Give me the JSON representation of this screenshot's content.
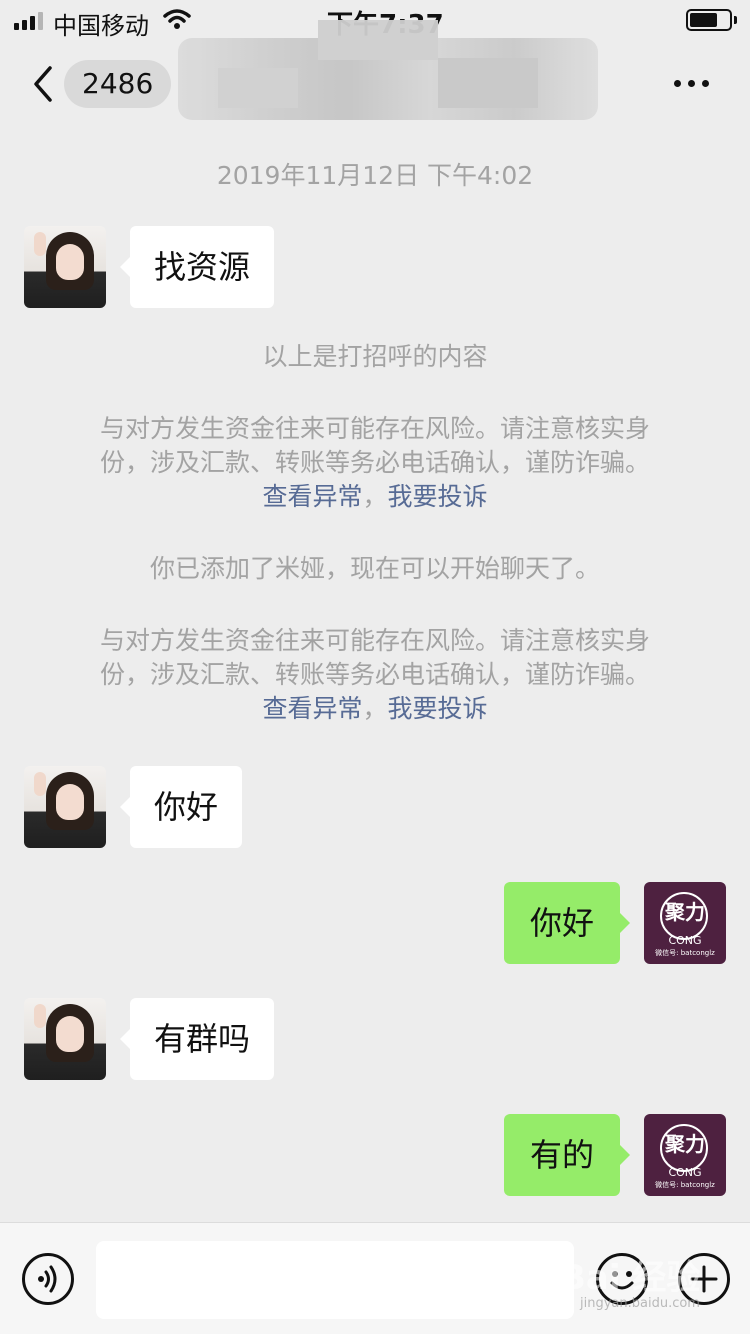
{
  "status_bar": {
    "carrier": "中国移动",
    "time": "下午7:37",
    "battery_level": 0.7,
    "icons": [
      "signal-icon",
      "wifi-icon",
      "battery-icon"
    ]
  },
  "nav": {
    "back_icon": "chevron-left-icon",
    "unread_count": "2486",
    "more_icon": "more-dots-icon"
  },
  "chat": {
    "timestamp": "2019年11月12日 下午4:02",
    "messages": [
      {
        "side": "left",
        "text": "找资源"
      },
      {
        "side": "left",
        "text": "你好"
      },
      {
        "side": "right",
        "text": "你好"
      },
      {
        "side": "left",
        "text": "有群吗"
      },
      {
        "side": "right",
        "text": "有的"
      }
    ],
    "system_notes": {
      "greeting_note": "以上是打招呼的内容",
      "risk_line1": "与对方发生资金往来可能存在风险。请注意核实身",
      "risk_line2": "份，涉及汇款、转账等务必电话确认，谨防诈骗。",
      "view_link": "查看异常",
      "separator": "，",
      "report_link": "我要投诉",
      "added_note": "你已添加了米娅，现在可以开始聊天了。"
    }
  },
  "my_avatar": {
    "brand": "聚力",
    "name": "CONG",
    "subtitle": "微信号: batconglz"
  },
  "input_bar": {
    "placeholder": "",
    "voice_icon": "voice-icon",
    "emoji_icon": "emoji-icon",
    "plus_icon": "plus-icon"
  },
  "watermark": {
    "text": "Bai 经验",
    "url": "jingyan.baidu.com"
  }
}
